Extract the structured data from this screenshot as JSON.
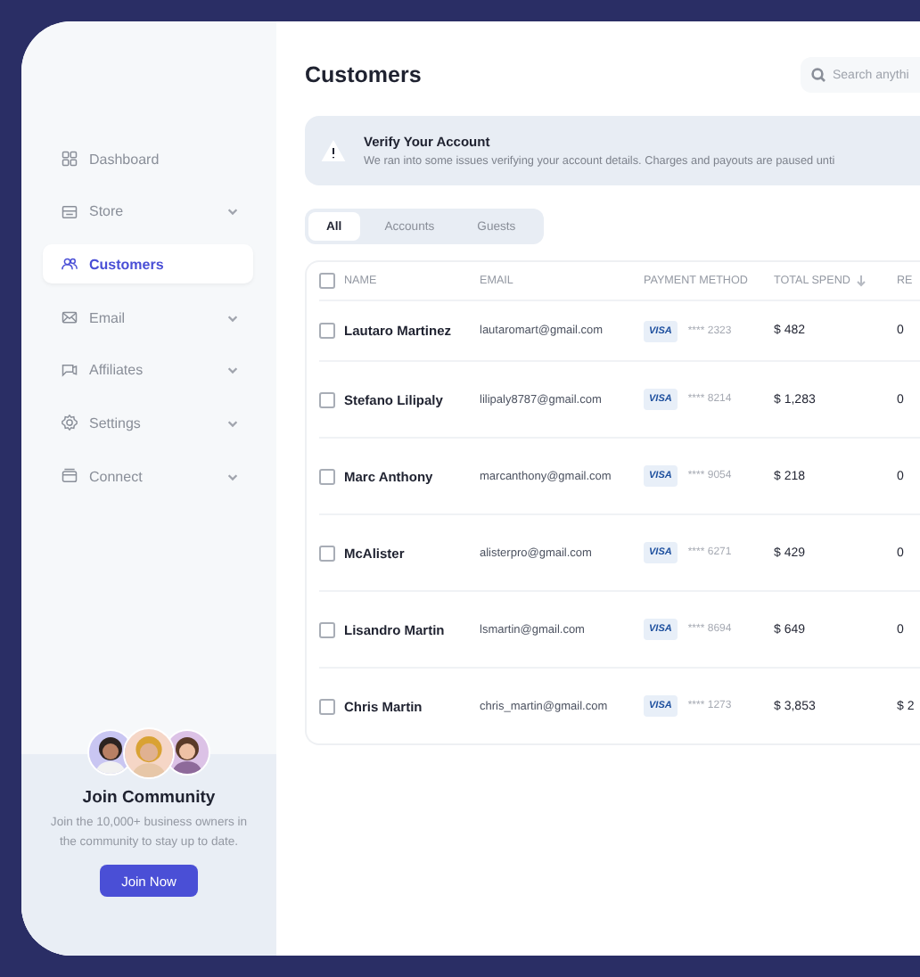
{
  "sidebar": {
    "items": [
      {
        "label": "Dashboard",
        "selected": false,
        "has_submenu": false
      },
      {
        "label": "Store",
        "selected": false,
        "has_submenu": true
      },
      {
        "label": "Customers",
        "selected": true,
        "has_submenu": false
      },
      {
        "label": "Email",
        "selected": false,
        "has_submenu": true
      },
      {
        "label": "Affiliates",
        "selected": false,
        "has_submenu": true
      },
      {
        "label": "Settings",
        "selected": false,
        "has_submenu": true
      },
      {
        "label": "Connect",
        "selected": false,
        "has_submenu": true
      }
    ],
    "community": {
      "title": "Join Community",
      "text": "Join the 10,000+ business owners in the community to stay up to date.",
      "button": "Join Now"
    }
  },
  "header": {
    "title": "Customers",
    "search": {
      "placeholder": "Search anythi"
    }
  },
  "alert": {
    "title": "Verify Your Account",
    "text": "We ran into some issues verifying your account details. Charges and payouts are paused unti"
  },
  "tabs": [
    {
      "label": "All",
      "selected": true
    },
    {
      "label": "Accounts",
      "selected": false
    },
    {
      "label": "Guests",
      "selected": false
    }
  ],
  "table": {
    "header_checked": false,
    "columns": [
      "NAME",
      "EMAIL",
      "PAYMENT METHOD",
      "TOTAL SPEND",
      "RE"
    ],
    "rows": [
      {
        "checked": false,
        "name": "Lautaro Martinez",
        "email": "lautaromart@gmail.com",
        "card": "VISA",
        "number": "**** 2323",
        "total": "$ 482",
        "column_6": "0"
      },
      {
        "checked": false,
        "name": "Stefano Lilipaly",
        "email": "lilipaly8787@gmail.com",
        "card": "VISA",
        "number": "**** 8214",
        "total": "$ 1,283",
        "column_6": "0"
      },
      {
        "checked": false,
        "name": "Marc Anthony",
        "email": "marcanthony@gmail.com",
        "card": "VISA",
        "number": "**** 9054",
        "total": "$ 218",
        "column_6": "0"
      },
      {
        "checked": false,
        "name": "McAlister",
        "email": "alisterpro@gmail.com",
        "card": "VISA",
        "number": "**** 6271",
        "total": "$ 429",
        "column_6": "0"
      },
      {
        "checked": false,
        "name": "Lisandro Martin",
        "email": "lsmartin@gmail.com",
        "card": "VISA",
        "number": "**** 8694",
        "total": "$ 649",
        "column_6": "0"
      },
      {
        "checked": false,
        "name": "Chris Martin",
        "email": "chris_martin@gmail.com",
        "card": "VISA",
        "number": "**** 1273",
        "total": "$ 3,853",
        "column_6": "$ 2"
      }
    ]
  }
}
